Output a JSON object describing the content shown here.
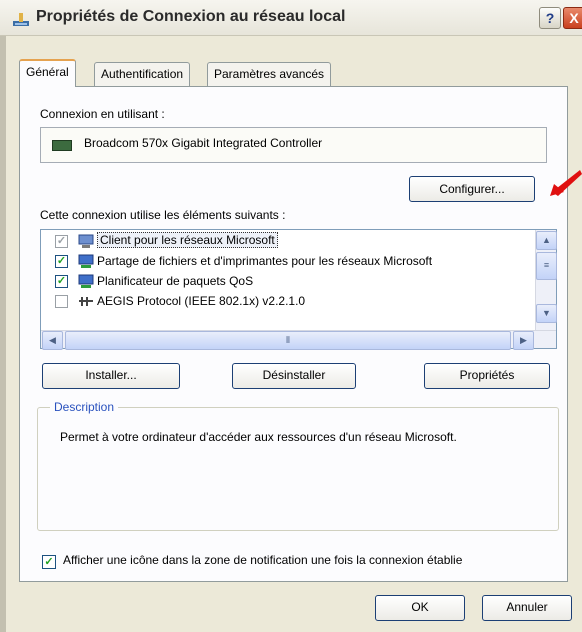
{
  "window": {
    "title": "Propriétés de Connexion au réseau local",
    "help_label": "?",
    "close_label": "X"
  },
  "tabs": [
    {
      "label": "Général",
      "active": true
    },
    {
      "label": "Authentification",
      "active": false
    },
    {
      "label": "Paramètres avancés",
      "active": false
    }
  ],
  "connection": {
    "label": "Connexion en utilisant :",
    "adapter_icon": "network-card-icon",
    "adapter": "Broadcom 570x Gigabit Integrated Controller",
    "configure_label": "Configurer..."
  },
  "components": {
    "label": "Cette connexion utilise les éléments suivants :",
    "items": [
      {
        "label": "Client pour les réseaux Microsoft",
        "checked": true,
        "enabled": false,
        "icon": "network-client-icon"
      },
      {
        "label": "Partage de fichiers et d'imprimantes pour les réseaux Microsoft",
        "checked": true,
        "enabled": true,
        "icon": "service-icon"
      },
      {
        "label": "Planificateur de paquets QoS",
        "checked": true,
        "enabled": true,
        "icon": "service-icon"
      },
      {
        "label": "AEGIS Protocol (IEEE 802.1x) v2.2.1.0",
        "checked": false,
        "enabled": true,
        "icon": "protocol-icon"
      }
    ]
  },
  "buttons": {
    "install": "Installer...",
    "uninstall": "Désinstaller",
    "properties": "Propriétés",
    "ok": "OK",
    "cancel": "Annuler"
  },
  "description": {
    "title": "Description",
    "text": "Permet à votre ordinateur d'accéder aux ressources d'un réseau Microsoft."
  },
  "notify": {
    "checked": true,
    "label": "Afficher une icône dans la zone de notification une fois la connexion établie"
  },
  "colors": {
    "accent": "#2a52be",
    "annotation_arrow": "#e01010"
  }
}
